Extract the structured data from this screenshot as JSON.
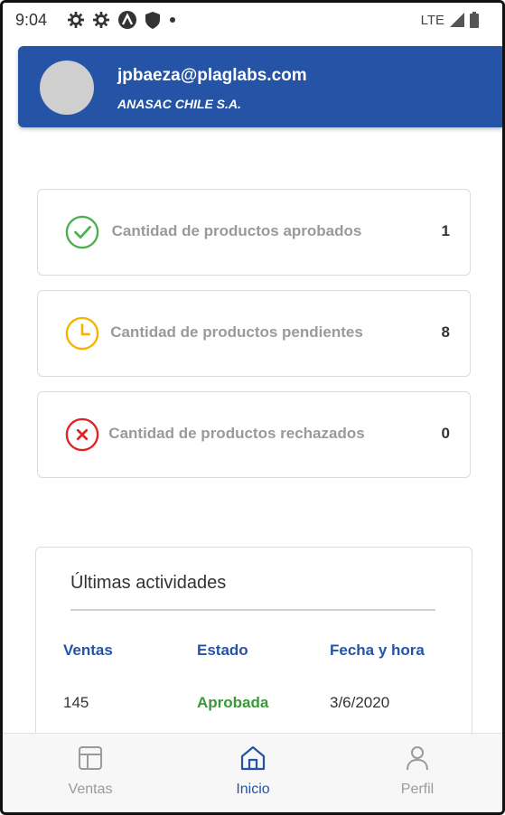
{
  "status_bar": {
    "time": "9:04",
    "network": "LTE"
  },
  "profile": {
    "email": "jpbaeza@plaglabs.com",
    "company": "ANASAC CHILE S.A."
  },
  "stats": [
    {
      "label": "Cantidad de productos aprobados",
      "value": "1",
      "icon": "check-circle-icon",
      "color": "#4CAF50"
    },
    {
      "label": "Cantidad de productos pendientes",
      "value": "8",
      "icon": "clock-icon",
      "color": "#F5B400"
    },
    {
      "label": "Cantidad de productos rechazados",
      "value": "0",
      "icon": "x-circle-icon",
      "color": "#E02424"
    }
  ],
  "activities": {
    "title": "Últimas actividades",
    "headers": [
      "Ventas",
      "Estado",
      "Fecha y hora"
    ],
    "rows": [
      [
        "145",
        "Aprobada",
        "3/6/2020"
      ]
    ]
  },
  "bottom_nav": [
    {
      "label": "Ventas",
      "icon": "table-layout-icon",
      "active": false
    },
    {
      "label": "Inicio",
      "icon": "home-icon",
      "active": true
    },
    {
      "label": "Perfil",
      "icon": "person-icon",
      "active": false
    }
  ],
  "colors": {
    "brand": "#2553A6",
    "approved": "#3a9a3a"
  }
}
